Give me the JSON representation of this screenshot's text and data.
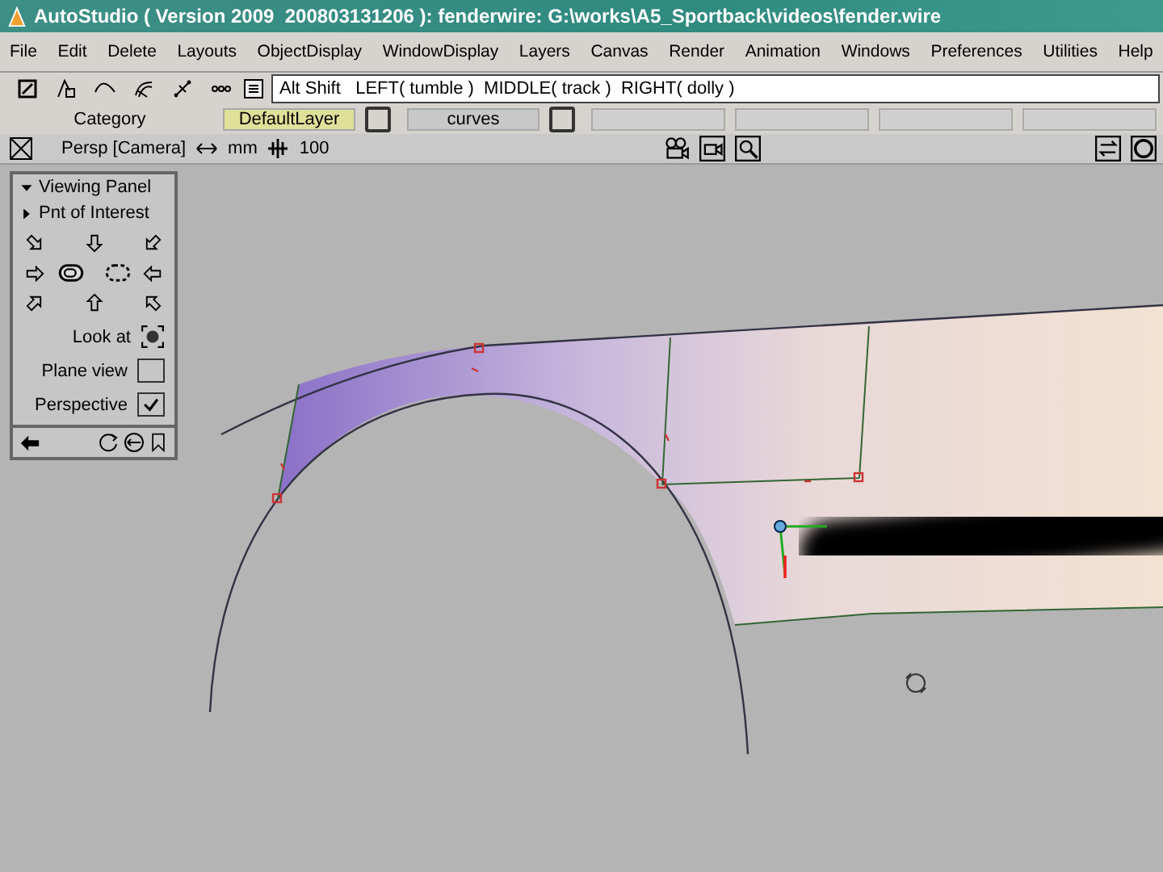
{
  "window": {
    "title": "AutoStudio ( Version 2009  200803131206 ): fenderwire: G:\\works\\A5_Sportback\\videos\\fender.wire"
  },
  "menu": [
    "File",
    "Edit",
    "Delete",
    "Layouts",
    "ObjectDisplay",
    "WindowDisplay",
    "Layers",
    "Canvas",
    "Render",
    "Animation",
    "Windows",
    "Preferences",
    "Utilities",
    "Help"
  ],
  "toolbar": {
    "command": "Alt Shift   LEFT( tumble )  MIDDLE( track )  RIGHT( dolly )"
  },
  "layers": {
    "category": "Category",
    "items": [
      {
        "label": "DefaultLayer",
        "selected": true
      },
      {
        "label": "curves",
        "selected": false
      }
    ]
  },
  "view": {
    "camera": "Persp [Camera]",
    "units": "mm",
    "grid": "100"
  },
  "viewing_panel": {
    "title": "Viewing Panel",
    "expanded": true,
    "subsection": "Pnt of Interest",
    "look_at": "Look at",
    "options": [
      {
        "label": "Plane view",
        "checked": false
      },
      {
        "label": "Perspective",
        "checked": true
      }
    ]
  }
}
